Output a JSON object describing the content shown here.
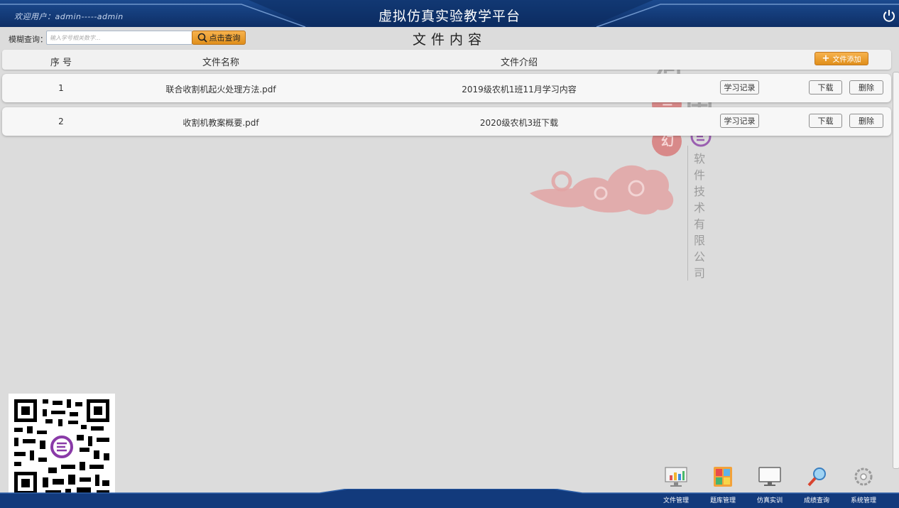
{
  "header": {
    "welcome_text": "欢迎用户：admin-----admin",
    "app_title": "虚拟仿真实验教学平台",
    "power_icon": "power-icon"
  },
  "search": {
    "label": "模糊查询：",
    "placeholder": "输入学号相关数字...",
    "button_label": "点击查询"
  },
  "page_title": "文件内容",
  "table": {
    "headers": {
      "index": "序 号",
      "name": "文件名称",
      "intro": "文件介绍"
    },
    "add_button_label": "文件添加",
    "rows": [
      {
        "index": "1",
        "name": "联合收割机起火处理方法.pdf",
        "intro": "2019级农机1班11月学习内容",
        "record_label": "学习记录",
        "download_label": "下载",
        "delete_label": "删除"
      },
      {
        "index": "2",
        "name": "收割机教案概要.pdf",
        "intro": "2020级农机3班下载",
        "record_label": "学习记录",
        "download_label": "下载",
        "delete_label": "删除"
      }
    ]
  },
  "watermark": {
    "big_1": "河",
    "big_2": "南",
    "seal_1": "兰",
    "seal_2": "幻",
    "vertical": [
      "软",
      "件",
      "技",
      "术",
      "有",
      "限",
      "公",
      "司"
    ]
  },
  "dock": {
    "items": [
      {
        "label": "文件管理",
        "icon": "chart-monitor-icon"
      },
      {
        "label": "题库管理",
        "icon": "grid-cards-icon"
      },
      {
        "label": "仿真实训",
        "icon": "monitor-icon"
      },
      {
        "label": "成绩查询",
        "icon": "magnifier-icon"
      },
      {
        "label": "系统管理",
        "icon": "gear-icon"
      }
    ]
  },
  "colors": {
    "header_blue": "#12397a",
    "accent_orange": "#e89a24",
    "background": "#dcdcdc"
  }
}
